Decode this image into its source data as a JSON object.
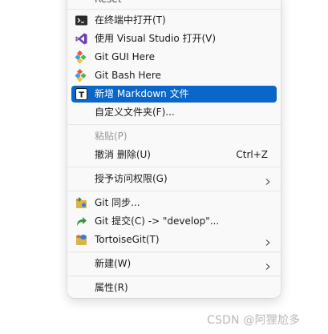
{
  "context_menu": {
    "top_partial_label": "Reset",
    "items": {
      "open_terminal": "在终端中打开(T)",
      "open_vs": "使用 Visual Studio 打开(V)",
      "git_gui": "Git GUI Here",
      "git_bash": "Git Bash Here",
      "new_markdown": "新增 Markdown 文件",
      "custom_folder": "自定义文件夹(F)...",
      "paste": "粘贴(P)",
      "undo_delete": "撤消 删除(U)",
      "undo_delete_shortcut": "Ctrl+Z",
      "grant_access": "授予访问权限(G)",
      "git_sync": "Git 同步...",
      "git_commit": "Git 提交(C) -> \"develop\"...",
      "tortoisegit": "TortoiseGit(T)",
      "new": "新建(W)",
      "properties": "属性(R)"
    },
    "highlighted_item": "new_markdown",
    "accent_color": "#0a67c9"
  },
  "watermark": "CSDN @阿狸尬多"
}
